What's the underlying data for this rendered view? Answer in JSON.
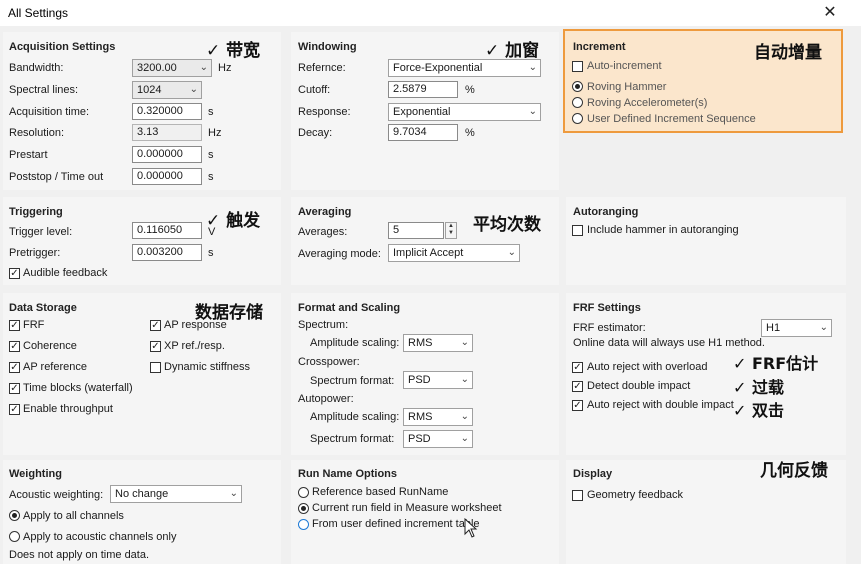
{
  "window": {
    "title": "All Settings",
    "close_glyph": "✕"
  },
  "acquisition": {
    "header": "Acquisition Settings",
    "note": "✓  带宽",
    "bandwidth_label": "Bandwidth:",
    "bandwidth_value": "3200.00",
    "bandwidth_unit": "Hz",
    "spectral_lines_label": "Spectral lines:",
    "spectral_lines_value": "1024",
    "acq_time_label": "Acquisition time:",
    "acq_time_value": "0.320000",
    "acq_time_unit": "s",
    "resolution_label": "Resolution:",
    "resolution_value": "3.13",
    "resolution_unit": "Hz",
    "prestart_label": "Prestart",
    "prestart_value": "0.000000",
    "prestart_unit": "s",
    "poststop_label": "Poststop / Time out",
    "poststop_value": "0.000000",
    "poststop_unit": "s"
  },
  "windowing": {
    "header": "Windowing",
    "note": "✓  加窗",
    "reference_label": "Refernce:",
    "reference_value": "Force-Exponential",
    "cutoff_label": "Cutoff:",
    "cutoff_value": "2.5879",
    "cutoff_unit": "%",
    "response_label": "Response:",
    "response_value": "Exponential",
    "decay_label": "Decay:",
    "decay_value": "9.7034",
    "decay_unit": "%"
  },
  "increment": {
    "header": "Increment",
    "note": "自动增量",
    "auto_label": "Auto-increment",
    "auto_checked": false,
    "options": [
      "Roving Hammer",
      "Roving Accelerometer(s)",
      "User Defined Increment Sequence"
    ],
    "selected": "Roving Hammer",
    "highlight_color": "#fbe6cc",
    "border_color": "#ee9a3d"
  },
  "triggering": {
    "header": "Triggering",
    "note": "✓  触发",
    "level_label": "Trigger level:",
    "level_value": "0.116050",
    "level_unit": "V",
    "pretrigger_label": "Pretrigger:",
    "pretrigger_value": "0.003200",
    "pretrigger_unit": "s",
    "audible_label": "Audible feedback",
    "audible_checked": true
  },
  "averaging": {
    "header": "Averaging",
    "note": "平均次数",
    "averages_label": "Averages:",
    "averages_value": "5",
    "mode_label": "Averaging mode:",
    "mode_value": "Implicit Accept"
  },
  "autoranging": {
    "header": "Autoranging",
    "include_label": "Include hammer in autoranging",
    "include_checked": false
  },
  "data_storage": {
    "header": "Data Storage",
    "note": "数据存储",
    "items_left": [
      {
        "label": "FRF",
        "checked": true
      },
      {
        "label": "Coherence",
        "checked": true
      },
      {
        "label": "AP reference",
        "checked": true
      },
      {
        "label": "Time blocks (waterfall)",
        "checked": true
      },
      {
        "label": "Enable throughput",
        "checked": true
      }
    ],
    "items_right": [
      {
        "label": "AP response",
        "checked": true
      },
      {
        "label": "XP ref./resp.",
        "checked": true
      },
      {
        "label": "Dynamic stiffness",
        "checked": false
      }
    ]
  },
  "format": {
    "header": "Format and Scaling",
    "spectrum_label": "Spectrum:",
    "spec_amp_label": "Amplitude scaling:",
    "spec_amp_value": "RMS",
    "crosspower_label": "Crosspower:",
    "cross_fmt_label": "Spectrum format:",
    "cross_fmt_value": "PSD",
    "autopower_label": "Autopower:",
    "auto_amp_label": "Amplitude scaling:",
    "auto_amp_value": "RMS",
    "auto_fmt_label": "Spectrum format:",
    "auto_fmt_value": "PSD"
  },
  "frf": {
    "header": "FRF Settings",
    "estimator_label": "FRF estimator:",
    "estimator_value": "H1",
    "online_note": "Online data will always use H1 method.",
    "items": [
      {
        "label": "Auto reject with overload",
        "checked": true,
        "note": "✓  FRF估计"
      },
      {
        "label": "Detect double impact",
        "checked": true,
        "note": "✓  过载"
      },
      {
        "label": "Auto reject with double impact",
        "checked": true,
        "note": "✓  双击"
      }
    ]
  },
  "weighting": {
    "header": "Weighting",
    "acoustic_label": "Acoustic weighting:",
    "acoustic_value": "No change",
    "opt_all": "Apply to all channels",
    "opt_acoustic": "Apply to acoustic channels only",
    "selected": "Apply to all channels",
    "time_note": "Does not apply on time data."
  },
  "run_name": {
    "header": "Run Name Options",
    "options": [
      "Reference based RunName",
      "Current run field in Measure worksheet",
      "From user defined increment table"
    ],
    "selected": "Current run field in Measure worksheet"
  },
  "display": {
    "header": "Display",
    "note": "几何反馈",
    "geometry_label": "Geometry feedback",
    "geometry_checked": false
  }
}
